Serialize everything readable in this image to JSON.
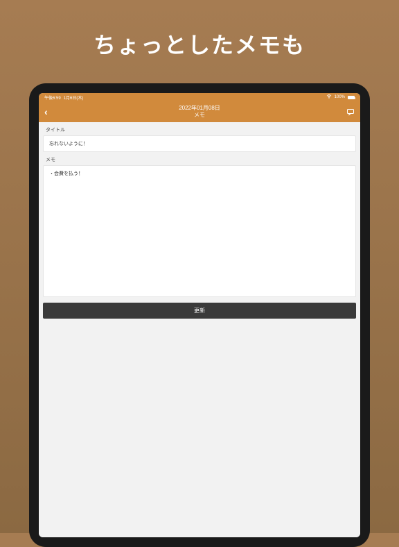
{
  "promo": {
    "headline": "ちょっとしたメモも"
  },
  "status_bar": {
    "time": "午後6:59",
    "date": "1月6日(木)",
    "wifi": true,
    "battery_pct": "100%"
  },
  "nav": {
    "back_glyph": "‹",
    "title_line1": "2022年01月08日",
    "title_line2": "メモ"
  },
  "form": {
    "title_label": "タイトル",
    "title_value": "忘れないように！",
    "memo_label": "メモ",
    "memo_value": "・会費を払う！",
    "update_button": "更新"
  },
  "colors": {
    "bg_top": "#a67c52",
    "bg_bottom": "#8b6942",
    "accent": "#d18a3c",
    "button_bg": "#3a3a3a"
  }
}
